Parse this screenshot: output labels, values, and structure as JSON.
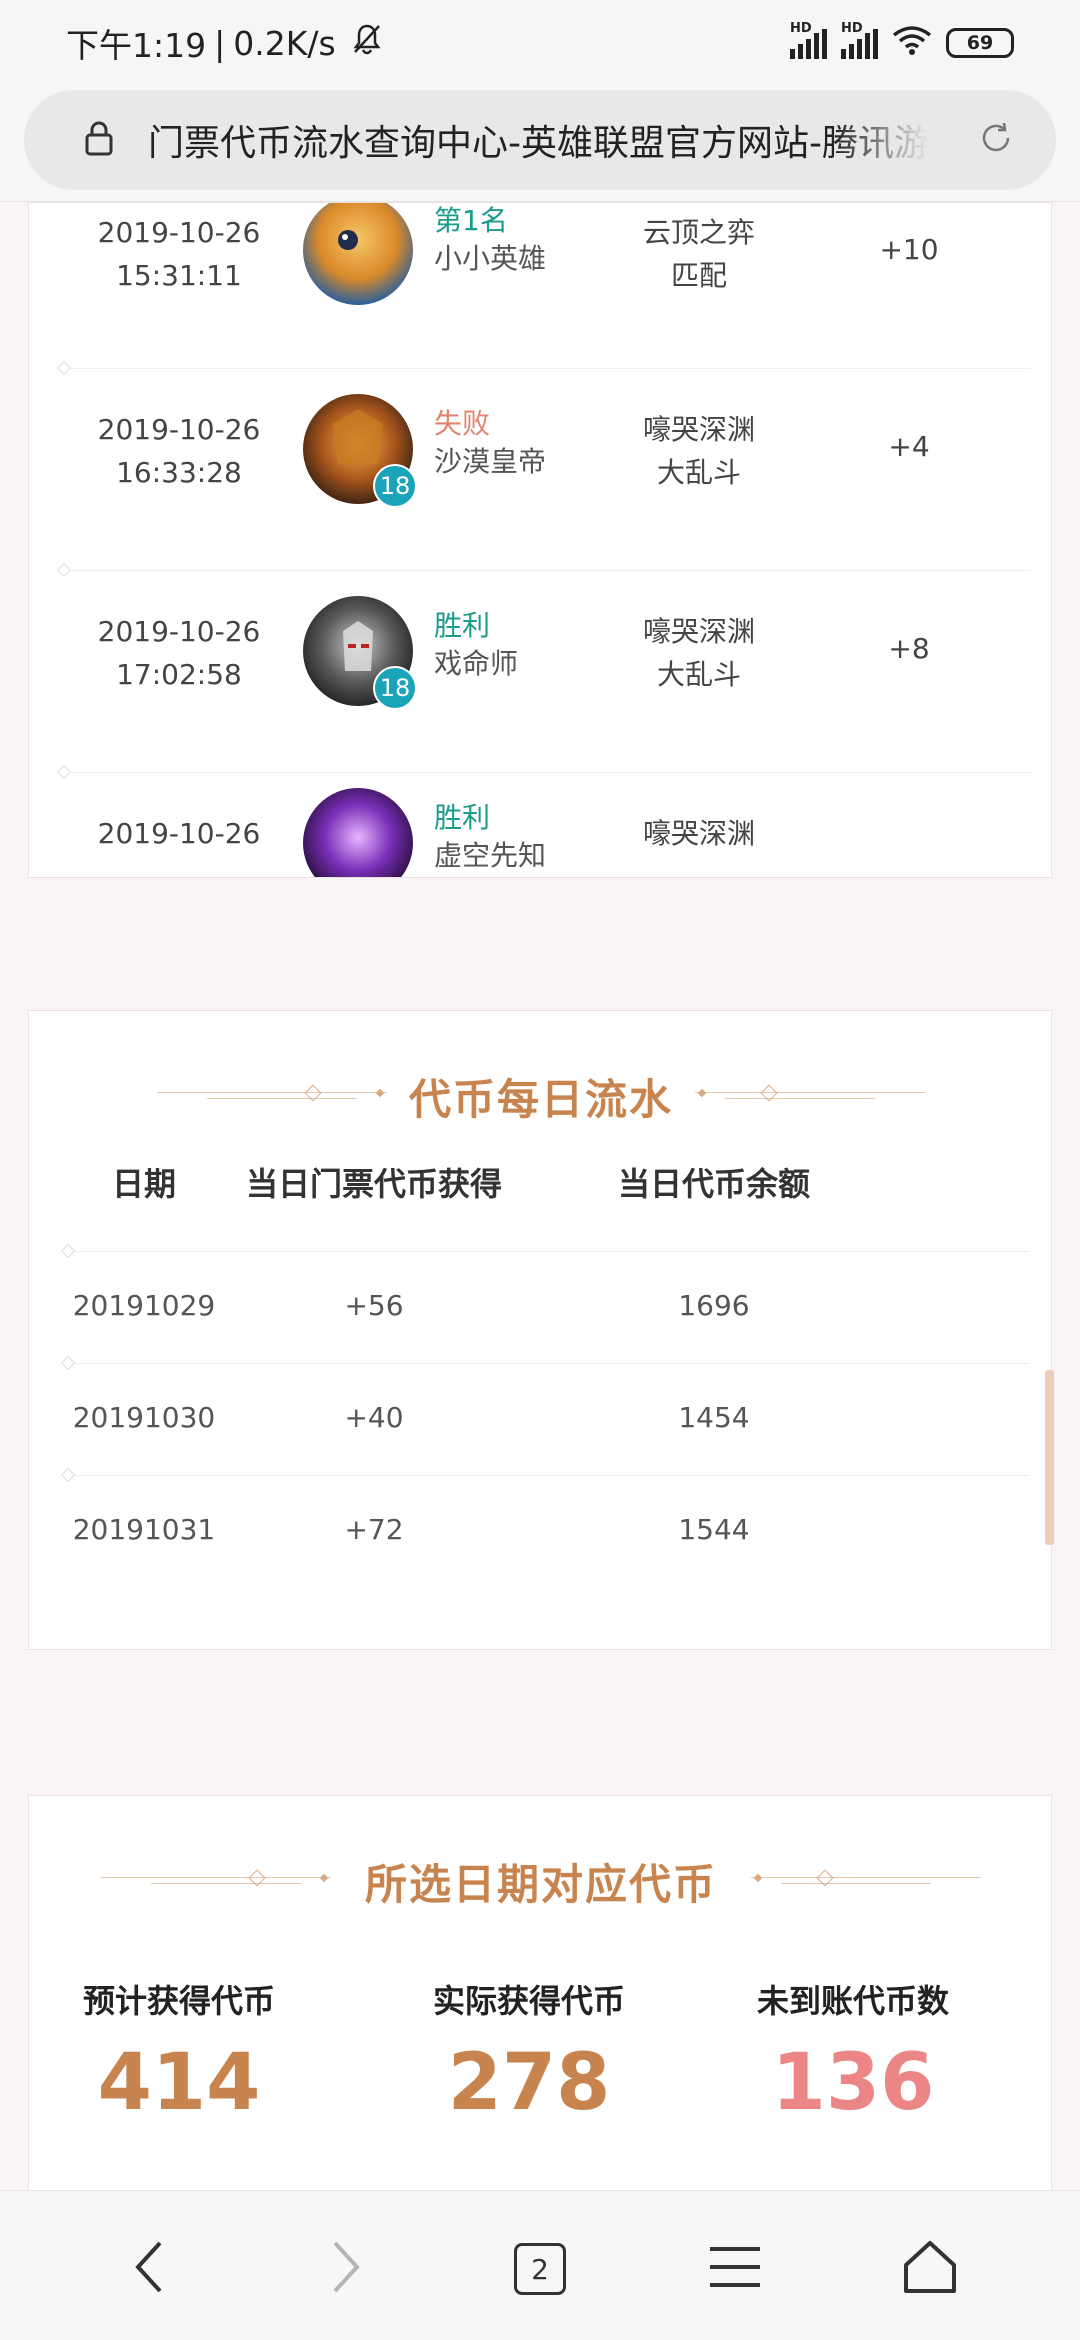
{
  "status_bar": {
    "time": "下午1:19",
    "separator": "|",
    "net_speed": "0.2K/s",
    "sim1_label": "HD",
    "sim2_label": "HD",
    "battery": "69"
  },
  "browser": {
    "url_title": "门票代币流水查询中心-英雄联盟官方网站-腾讯游戏",
    "tab_count": "2"
  },
  "match_list": {
    "rows": [
      {
        "date": "2019-10-26",
        "time": "15:31:11",
        "result": "第1名",
        "result_type": "win",
        "champion": "小小英雄",
        "mode_line1": "云顶之弈",
        "mode_line2": "匹配",
        "points": "+10",
        "level": ""
      },
      {
        "date": "2019-10-26",
        "time": "16:33:28",
        "result": "失败",
        "result_type": "lose",
        "champion": "沙漠皇帝",
        "mode_line1": "嚎哭深渊",
        "mode_line2": "大乱斗",
        "points": "+4",
        "level": "18"
      },
      {
        "date": "2019-10-26",
        "time": "17:02:58",
        "result": "胜利",
        "result_type": "win",
        "champion": "戏命师",
        "mode_line1": "嚎哭深渊",
        "mode_line2": "大乱斗",
        "points": "+8",
        "level": "18"
      },
      {
        "date": "2019-10-26",
        "time": "",
        "result": "胜利",
        "result_type": "win",
        "champion": "虚空先知",
        "mode_line1": "嚎哭深渊",
        "mode_line2": "",
        "points": "",
        "level": ""
      }
    ],
    "colors": {
      "win": "#1a9c8b",
      "lose": "#e0846d"
    }
  },
  "daily_flow": {
    "title": "代币每日流水",
    "headers": [
      "日期",
      "当日门票代币获得",
      "当日代币余额"
    ],
    "rows": [
      [
        "20191029",
        "+56",
        "1696"
      ],
      [
        "20191030",
        "+40",
        "1454"
      ],
      [
        "20191031",
        "+72",
        "1544"
      ]
    ]
  },
  "summary": {
    "title": "所选日期对应代币",
    "items": [
      {
        "label": "预计获得代币",
        "value": "414",
        "color": "#c8844e"
      },
      {
        "label": "实际获得代币",
        "value": "278",
        "color": "#c8844e"
      },
      {
        "label": "未到账代币数",
        "value": "136",
        "color": "#ec8686"
      }
    ]
  },
  "nav": {
    "back_icon": "chevron-left-icon",
    "forward_icon": "chevron-right-icon",
    "tabs_icon": "tabs-icon",
    "menu_icon": "menu-icon",
    "home_icon": "home-icon"
  }
}
